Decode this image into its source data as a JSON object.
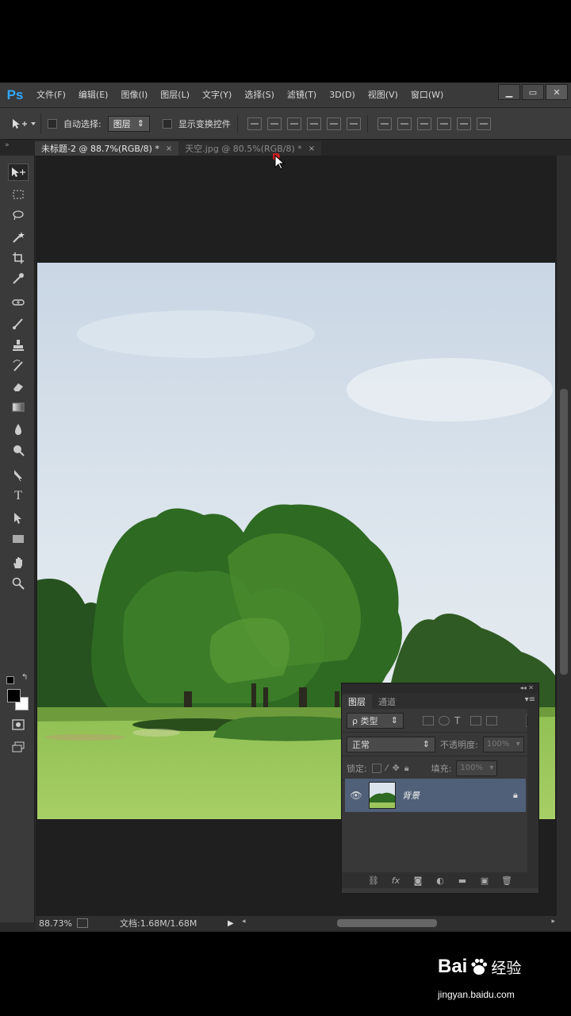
{
  "app": {
    "logo": "Ps",
    "menu": [
      "文件(F)",
      "编辑(E)",
      "图像(I)",
      "图层(L)",
      "文字(Y)",
      "选择(S)",
      "滤镜(T)",
      "3D(D)",
      "视图(V)",
      "窗口(W)"
    ],
    "window_controls": [
      "minimize-icon",
      "maximize-icon",
      "close-icon"
    ]
  },
  "options_bar": {
    "auto_select_label": "自动选择:",
    "auto_select_value": "图层",
    "show_transform_label": "显示变换控件"
  },
  "tabs": [
    {
      "label": "未标题-2 @ 88.7%(RGB/8) *",
      "close": "×",
      "active": true
    },
    {
      "label": "天空.jpg @ 80.5%(RGB/8) *",
      "close": "×",
      "active": false
    }
  ],
  "status_bar": {
    "zoom": "88.73%",
    "doc": "文档:1.68M/1.68M"
  },
  "layers_panel": {
    "tabs": [
      "图层",
      "通道"
    ],
    "filter_value": "ρ 类型",
    "blend_mode": "正常",
    "opacity_label": "不透明度:",
    "opacity_value": "100%",
    "lock_label": "锁定:",
    "fill_label": "填充:",
    "fill_value": "100%",
    "layer_name": "背景"
  },
  "watermark": {
    "brand": "Bai",
    "brand_suffix": "经验",
    "url": "jingyan.baidu.com"
  },
  "colors": {
    "ps_blue": "#31a8ff",
    "selected_layer": "#506079",
    "cursor_highlight": "#e02020"
  }
}
